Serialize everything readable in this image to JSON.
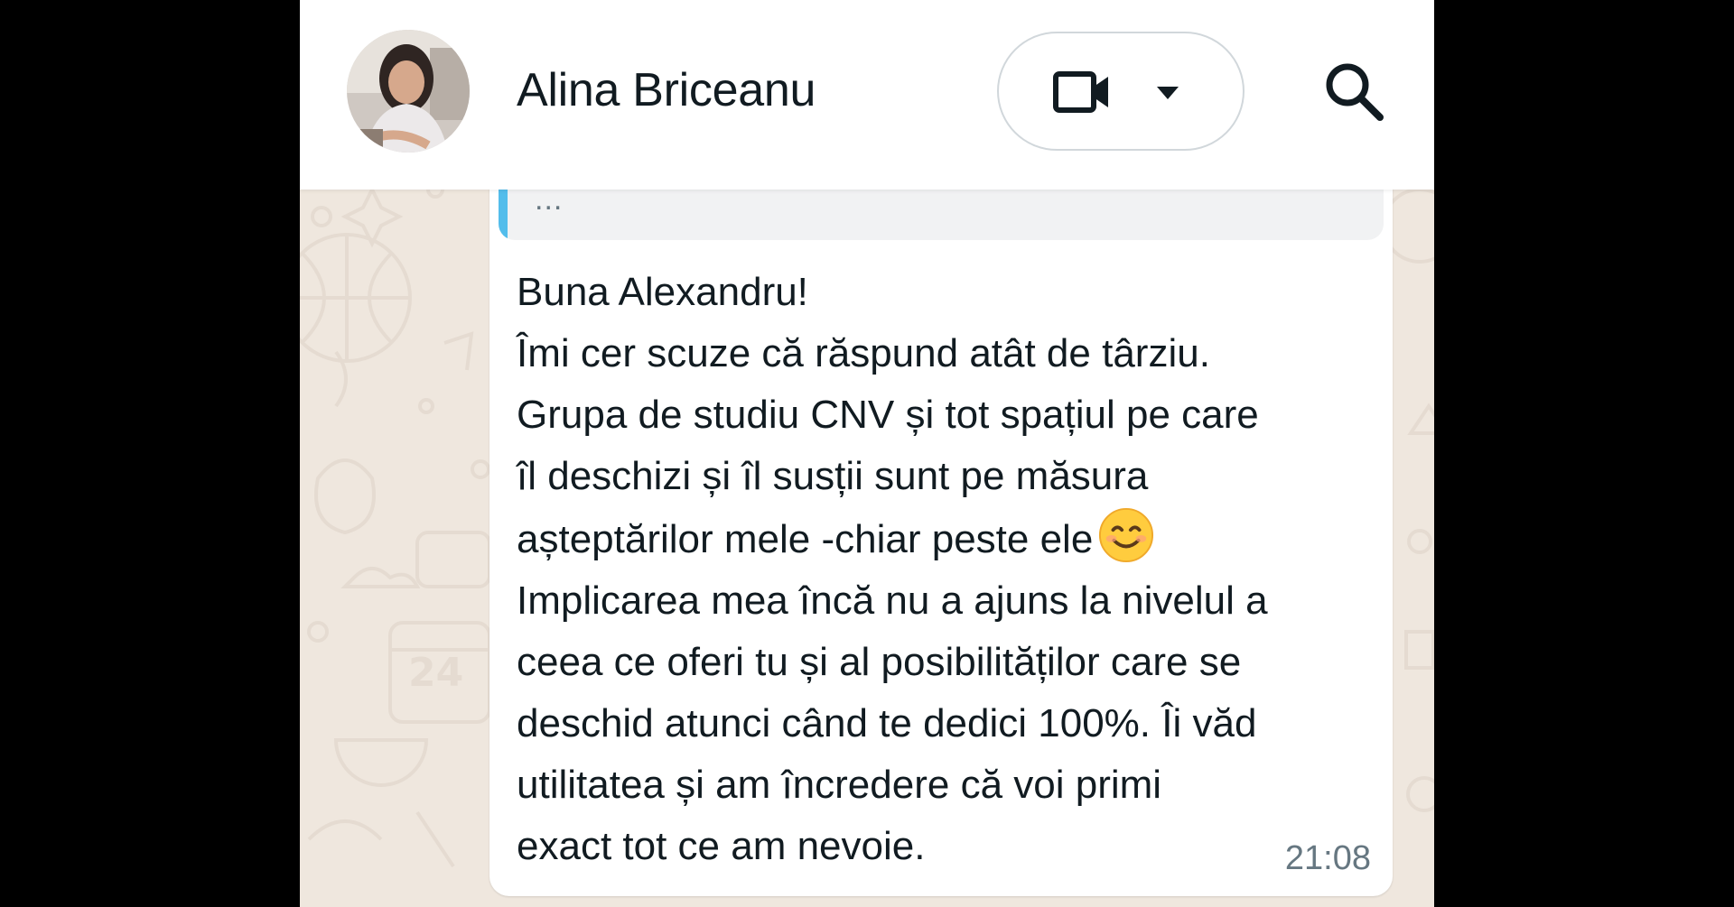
{
  "header": {
    "contact_name": "Alina Briceanu",
    "avatar_icon": "contact-avatar",
    "call_icon": "video-camera-icon",
    "call_menu_icon": "caret-down-icon",
    "search_icon": "search-icon"
  },
  "quoted_message": {
    "text": "...",
    "accent_color": "#53bdeb"
  },
  "message": {
    "lines": [
      "Buna Alexandru!",
      "Îmi cer scuze că răspund atât de târziu.",
      "Grupa de studiu CNV și tot spațiul pe care",
      "îl deschizi și îl susții sunt pe măsura",
      "așteptărilor mele -chiar peste ele",
      "Implicarea mea încă nu a ajuns la nivelul a",
      "ceea ce oferi tu și al posibilităților care se",
      "deschid atunci când te dedici 100%. Îi văd",
      "utilitatea și am încredere că voi primi",
      "exact tot ce am nevoie."
    ],
    "emoji": "smiling-face-emoji",
    "time": "21:08"
  },
  "colors": {
    "chat_background": "#efe7de",
    "bubble": "#ffffff",
    "text": "#111b21",
    "meta_text": "#667781"
  }
}
